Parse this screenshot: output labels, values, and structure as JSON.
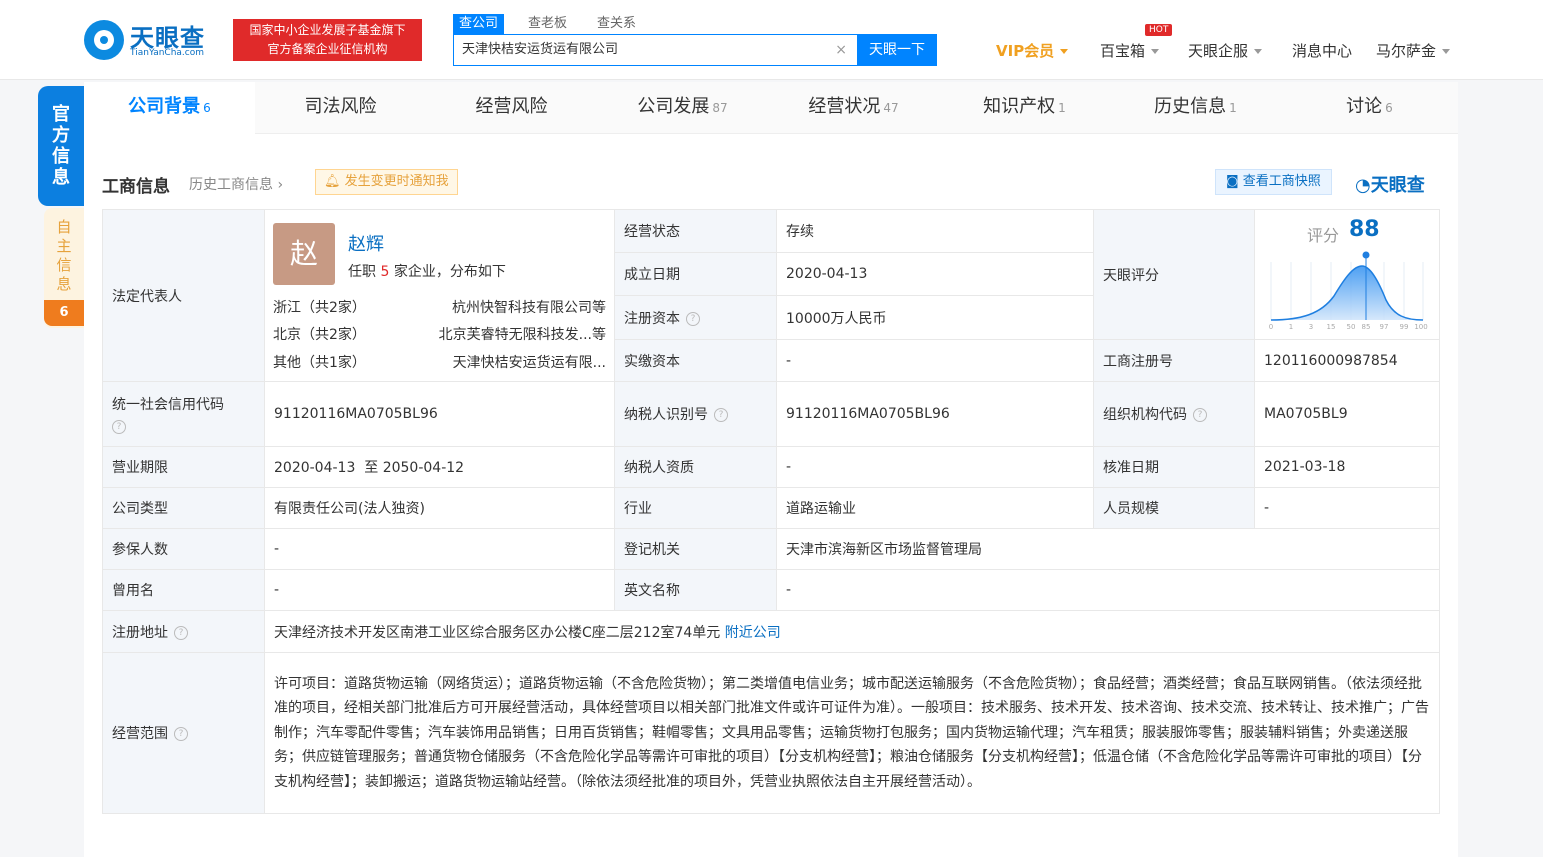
{
  "header": {
    "logo_cn": "天眼查",
    "logo_en": "TianYanCha.com",
    "badge_line1": "国家中小企业发展子基金旗下",
    "badge_line2": "官方备案企业征信机构",
    "search_tabs": [
      "查公司",
      "查老板",
      "查关系"
    ],
    "search_value": "天津快桔安运货运有限公司",
    "search_button": "天眼一下",
    "nav": {
      "vip": "VIP会员",
      "baibao": "百宝箱",
      "hot": "HOT",
      "qiye": "天眼企服",
      "messages": "消息中心",
      "user": "马尔萨金"
    }
  },
  "side": {
    "official": "官方信息",
    "self": "自主信息",
    "self_count": "6"
  },
  "tabs": [
    {
      "label": "公司背景",
      "count": "6"
    },
    {
      "label": "司法风险",
      "count": ""
    },
    {
      "label": "经营风险",
      "count": ""
    },
    {
      "label": "公司发展",
      "count": "87"
    },
    {
      "label": "经营状况",
      "count": "47"
    },
    {
      "label": "知识产权",
      "count": "1"
    },
    {
      "label": "历史信息",
      "count": "1"
    },
    {
      "label": "讨论",
      "count": "6"
    }
  ],
  "section": {
    "title": "工商信息",
    "history_link": "历史工商信息",
    "notify": "发生变更时通知我",
    "snapshot": "查看工商快照",
    "brand": "天眼查"
  },
  "rep": {
    "label": "法定代表人",
    "avatar_char": "赵",
    "name": "赵辉",
    "sub_prefix": "任职",
    "sub_count": "5",
    "sub_suffix": "家企业，分布如下",
    "rows": [
      {
        "region": "浙江（共2家）",
        "company": "杭州快智科技有限公司等"
      },
      {
        "region": "北京（共2家）",
        "company": "北京芙睿特无限科技发...等"
      },
      {
        "region": "其他（共1家）",
        "company": "天津快桔安运货运有限..."
      }
    ]
  },
  "info": {
    "status_label": "经营状态",
    "status": "存续",
    "established_label": "成立日期",
    "established": "2020-04-13",
    "capital_label": "注册资本",
    "capital": "10000万人民币",
    "paid_label": "实缴资本",
    "paid": "-",
    "score_label": "天眼评分",
    "score_prefix": "评分",
    "score": "88",
    "reg_no_label": "工商注册号",
    "reg_no": "120116000987854",
    "credit_label": "统一社会信用代码",
    "credit": "91120116MA0705BL96",
    "taxpayer_label": "纳税人识别号",
    "taxpayer": "91120116MA0705BL96",
    "org_label": "组织机构代码",
    "org": "MA0705BL9",
    "term_label": "营业期限",
    "term": "2020-04-13  至 2050-04-12",
    "tax_qual_label": "纳税人资质",
    "tax_qual": "-",
    "approve_label": "核准日期",
    "approve": "2021-03-18",
    "type_label": "公司类型",
    "type": "有限责任公司(法人独资)",
    "industry_label": "行业",
    "industry": "道路运输业",
    "staff_label": "人员规模",
    "staff": "-",
    "insured_label": "参保人数",
    "insured": "-",
    "authority_label": "登记机关",
    "authority": "天津市滨海新区市场监督管理局",
    "former_label": "曾用名",
    "former": "-",
    "en_label": "英文名称",
    "en": "-",
    "address_label": "注册地址",
    "address": "天津经济技术开发区南港工业区综合服务区办公楼C座二层212室74单元",
    "nearby": "附近公司",
    "scope_label": "经营范围",
    "scope": "许可项目：道路货物运输（网络货运）；道路货物运输（不含危险货物）；第二类增值电信业务；城市配送运输服务（不含危险货物）；食品经营；酒类经营；食品互联网销售。（依法须经批准的项目，经相关部门批准后方可开展经营活动，具体经营项目以相关部门批准文件或许可证件为准）。一般项目：技术服务、技术开发、技术咨询、技术交流、技术转让、技术推广；广告制作；汽车零配件零售；汽车装饰用品销售；日用百货销售；鞋帽零售；文具用品零售；运输货物打包服务；国内货物运输代理；汽车租赁；服装服饰零售；服装辅料销售；外卖递送服务；供应链管理服务；普通货物仓储服务（不含危险化学品等需许可审批的项目）【分支机构经营】；粮油仓储服务【分支机构经营】；低温仓储（不含危险化学品等需许可审批的项目）【分支机构经营】；装卸搬运；道路货物运输站经营。（除依法须经批准的项目外，凭营业执照依法自主开展经营活动）。"
  },
  "score_axis": [
    "0",
    "1",
    "3",
    "15",
    "50",
    "85",
    "97",
    "99",
    "100"
  ],
  "colors": {
    "accent": "#0084ff",
    "brand": "#0a6fc2",
    "badge": "#e02a2a",
    "vip": "#f0a020"
  }
}
